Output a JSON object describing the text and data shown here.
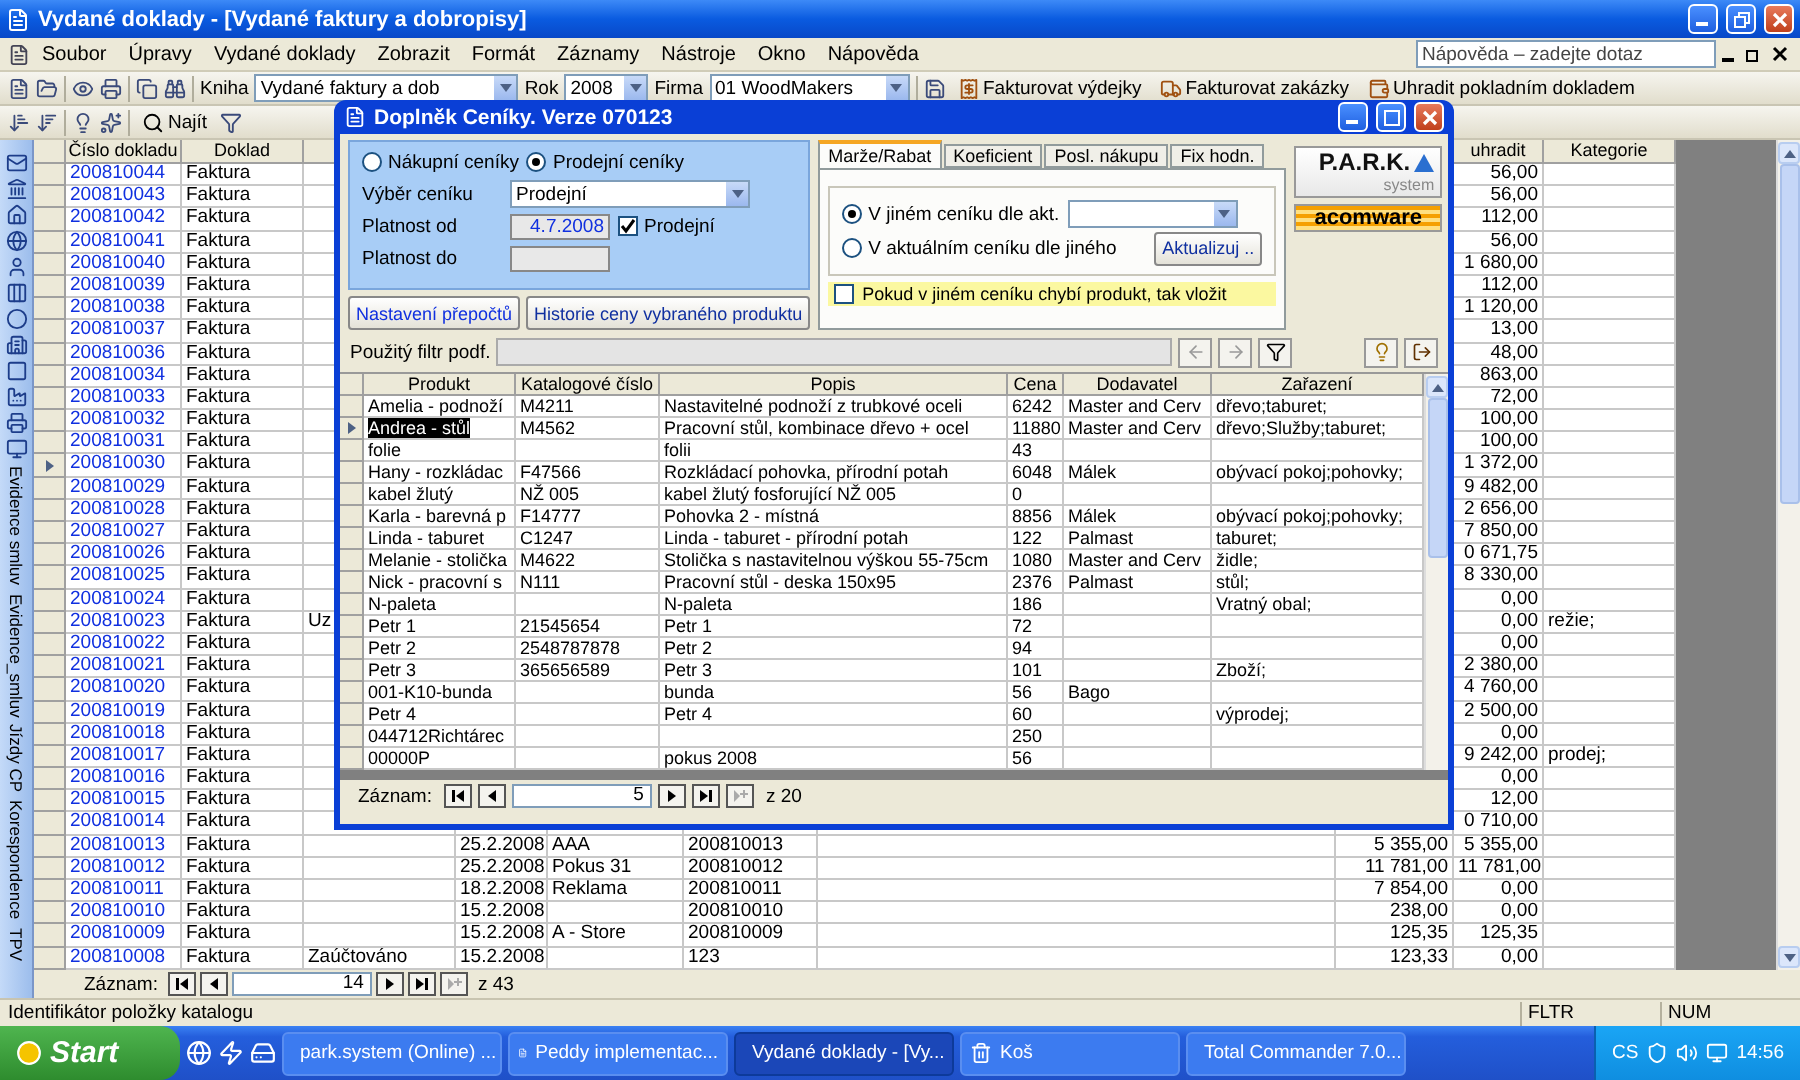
{
  "window": {
    "title": "Vydané doklady - [Vydané faktury a dobropisy]"
  },
  "menu": [
    "Soubor",
    "Úpravy",
    "Vydané doklady",
    "Zobrazit",
    "Formát",
    "Záznamy",
    "Nástroje",
    "Okno",
    "Nápověda"
  ],
  "help_box": {
    "placeholder": "Nápověda – zadejte dotaz"
  },
  "toolbar": {
    "kniha_label": "Kniha",
    "kniha": "Vydané faktury a dob",
    "rok_label": "Rok",
    "rok": "2008",
    "firma_label": "Firma",
    "firma": "01 WoodMakers",
    "actions": [
      "Fakturovat výdejky",
      "Fakturovat zakázky",
      "Uhradit pokladním dokladem"
    ]
  },
  "toolbar2": {
    "find": "Najít"
  },
  "sidebar": {
    "tabs": [
      "Evidence smluv",
      "Evidence_smluv",
      "Jízdy CP",
      "Korespondence",
      "TPV"
    ]
  },
  "table": {
    "headers": {
      "cislo_dokladu": "Číslo dokladu",
      "doklad": "Doklad",
      "uhradit": "uhradit",
      "kategorie": "Kategorie"
    },
    "rows": [
      {
        "cislo_dokladu": "200810044",
        "doklad": "Faktura",
        "uhradit": "56,00",
        "current": false
      },
      {
        "cislo_dokladu": "200810043",
        "doklad": "Faktura",
        "uhradit": "56,00",
        "current": false
      },
      {
        "cislo_dokladu": "200810042",
        "doklad": "Faktura",
        "uhradit": "112,00",
        "current": false
      },
      {
        "cislo_dokladu": "200810041",
        "doklad": "Faktura",
        "uhradit": "56,00",
        "current": false
      },
      {
        "cislo_dokladu": "200810040",
        "doklad": "Faktura",
        "uhradit": "1 680,00",
        "current": false
      },
      {
        "cislo_dokladu": "200810039",
        "doklad": "Faktura",
        "uhradit": "112,00",
        "current": false
      },
      {
        "cislo_dokladu": "200810038",
        "doklad": "Faktura",
        "uhradit": "1 120,00",
        "current": false
      },
      {
        "cislo_dokladu": "200810037",
        "doklad": "Faktura",
        "uhradit": "13,00",
        "current": false
      },
      {
        "cislo_dokladu": "200810036",
        "doklad": "Faktura",
        "uhradit": "48,00",
        "current": false
      },
      {
        "cislo_dokladu": "200810034",
        "doklad": "Faktura",
        "uhradit": "863,00",
        "current": false
      },
      {
        "cislo_dokladu": "200810033",
        "doklad": "Faktura",
        "uhradit": "72,00",
        "current": false
      },
      {
        "cislo_dokladu": "200810032",
        "doklad": "Faktura",
        "uhradit": "100,00",
        "current": false
      },
      {
        "cislo_dokladu": "200810031",
        "doklad": "Faktura",
        "uhradit": "100,00",
        "current": false
      },
      {
        "cislo_dokladu": "200810030",
        "doklad": "Faktura",
        "uhradit": "1 372,00",
        "current": true
      },
      {
        "cislo_dokladu": "200810029",
        "doklad": "Faktura",
        "uhradit": "9 482,00",
        "current": false
      },
      {
        "cislo_dokladu": "200810028",
        "doklad": "Faktura",
        "uhradit": "2 656,00",
        "current": false
      },
      {
        "cislo_dokladu": "200810027",
        "doklad": "Faktura",
        "uhradit": "7 850,00",
        "current": false
      },
      {
        "cislo_dokladu": "200810026",
        "doklad": "Faktura",
        "uhradit": "0 671,75",
        "current": false
      },
      {
        "cislo_dokladu": "200810025",
        "doklad": "Faktura",
        "uhradit": "8 330,00",
        "current": false
      },
      {
        "cislo_dokladu": "200810024",
        "doklad": "Faktura",
        "uhradit": "0,00",
        "current": false
      },
      {
        "cislo_dokladu": "200810023",
        "doklad": "Faktura",
        "column_3": "Uz",
        "uhradit": "0,00",
        "kategorie": "režie;",
        "current": false
      },
      {
        "cislo_dokladu": "200810022",
        "doklad": "Faktura",
        "uhradit": "0,00",
        "current": false
      },
      {
        "cislo_dokladu": "200810021",
        "doklad": "Faktura",
        "uhradit": "2 380,00",
        "current": false
      },
      {
        "cislo_dokladu": "200810020",
        "doklad": "Faktura",
        "uhradit": "4 760,00",
        "current": false
      },
      {
        "cislo_dokladu": "200810019",
        "doklad": "Faktura",
        "uhradit": "2 500,00",
        "current": false
      },
      {
        "cislo_dokladu": "200810018",
        "doklad": "Faktura",
        "uhradit": "0,00",
        "current": false
      },
      {
        "cislo_dokladu": "200810017",
        "doklad": "Faktura",
        "uhradit": "9 242,00",
        "kategorie": "prodej;",
        "current": false
      },
      {
        "cislo_dokladu": "200810016",
        "doklad": "Faktura",
        "uhradit": "0,00",
        "current": false
      },
      {
        "cislo_dokladu": "200810015",
        "doklad": "Faktura",
        "uhradit": "12,00",
        "current": false
      },
      {
        "cislo_dokladu": "200810014",
        "doklad": "Faktura",
        "uhradit": "0 710,00",
        "current": false
      },
      {
        "cislo_dokladu": "200810013",
        "doklad": "Faktura",
        "column_4": "25.2.2008",
        "column_5": "AAA",
        "column_6": "200810013",
        "column_8": "5 355,00",
        "uhradit": "5 355,00",
        "current": false
      },
      {
        "cislo_dokladu": "200810012",
        "doklad": "Faktura",
        "column_4": "25.2.2008",
        "column_5": "Pokus 31",
        "column_6": "200810012",
        "column_8": "11 781,00",
        "uhradit": "11 781,00",
        "current": false
      },
      {
        "cislo_dokladu": "200810011",
        "doklad": "Faktura",
        "column_4": "18.2.2008",
        "column_5": "Reklama",
        "column_6": "200810011",
        "column_8": "7 854,00",
        "uhradit": "0,00",
        "current": false
      },
      {
        "cislo_dokladu": "200810010",
        "doklad": "Faktura",
        "column_4": "15.2.2008",
        "column_6": "200810010",
        "column_8": "238,00",
        "uhradit": "0,00",
        "current": false
      },
      {
        "cislo_dokladu": "200810009",
        "doklad": "Faktura",
        "column_4": "15.2.2008",
        "column_5": "A - Store",
        "column_6": "200810009",
        "column_8": "125,35",
        "uhradit": "125,35",
        "current": false
      },
      {
        "cislo_dokladu": "200810008",
        "doklad": "Faktura",
        "column_3": "Zaúčtováno",
        "column_4": "15.2.2008",
        "column_6": "123",
        "column_8": "123,33",
        "uhradit": "0,00",
        "current": false
      }
    ]
  },
  "record_nav": {
    "label": "Záznam:",
    "current": "14",
    "total": "z 43"
  },
  "dialog": {
    "title": "Doplněk Ceníky. Verze 070123",
    "pricelist_type": [
      {
        "label": "Nákupní ceníky",
        "selected": false
      },
      {
        "label": "Prodejní ceníky",
        "selected": true
      }
    ],
    "pricelist": {
      "label": "Výběr ceníku",
      "value": "Prodejní"
    },
    "valid_from": {
      "label": "Platnost od",
      "value": "4.7.2008"
    },
    "valid_to": {
      "label": "Platnost do"
    },
    "sale_checkbox": {
      "label": "Prodejní",
      "checked": true
    },
    "buttons": [
      "Nastavení přepočtů",
      "Historie ceny vybraného produktu"
    ],
    "tabs": [
      {
        "label": "Marže/Rabat",
        "selected": true
      },
      {
        "label": "Koeficient",
        "selected": false
      },
      {
        "label": "Posl. nákupu",
        "selected": false
      },
      {
        "label": "Fix hodn.",
        "selected": false
      }
    ],
    "options": [
      {
        "label": "V jiném ceníku dle akt.",
        "selected": true
      },
      {
        "label": "V aktuálním ceníku dle jiného",
        "selected": false
      }
    ],
    "update_button": "Aktualizuj ..",
    "insert_checkbox": {
      "label": "Pokud v jiném ceníku chybí produkt, tak vložit",
      "checked": false
    },
    "logo_park": {
      "name": "P.A.R.K.",
      "sub": "system"
    },
    "logo_acomware": "acomware",
    "filter": {
      "label": "Použitý filtr podf."
    },
    "table": {
      "columns": [
        "Produkt",
        "Katalogové číslo",
        "Popis",
        "Cena",
        "Dodavatel",
        "Zařazení"
      ],
      "rows": [
        {
          "cells": {
            "produkt": "Amelia - podnoží",
            "katalogove_cislo": "M4211",
            "popis": "Nastavitelné podnoží z trubkové oceli",
            "cena": "6242",
            "dodavatel": "Master and Cerv",
            "zarazeni": "dřevo;taburet;"
          },
          "current": false
        },
        {
          "cells": {
            "produkt": "Andrea - stůl",
            "katalogove_cislo": "M4562",
            "popis": "Pracovní stůl, kombinace dřevo + ocel",
            "cena": "11880",
            "dodavatel": "Master and Cerv",
            "zarazeni": "dřevo;Služby;taburet;"
          },
          "current": true
        },
        {
          "cells": {
            "produkt": "folie",
            "popis": "folii",
            "cena": "43"
          },
          "current": false
        },
        {
          "cells": {
            "produkt": "Hany - rozkládac",
            "katalogove_cislo": "F47566",
            "popis": "Rozkládací pohovka, přírodní potah",
            "cena": "6048",
            "dodavatel": "Málek",
            "zarazeni": "obývací pokoj;pohovky;"
          },
          "current": false
        },
        {
          "cells": {
            "produkt": "kabel žlutý",
            "katalogove_cislo": "NŽ 005",
            "popis": "kabel žlutý fosforující NŽ 005",
            "cena": "0"
          },
          "current": false
        },
        {
          "cells": {
            "produkt": "Karla - barevná p",
            "katalogove_cislo": "F14777",
            "popis": "Pohovka 2 - místná",
            "cena": "8856",
            "dodavatel": "Málek",
            "zarazeni": "obývací pokoj;pohovky;"
          },
          "current": false
        },
        {
          "cells": {
            "produkt": "Linda - taburet",
            "katalogove_cislo": "C1247",
            "popis": "Linda - taburet - přírodní potah",
            "cena": "122",
            "dodavatel": "Palmast",
            "zarazeni": "taburet;"
          },
          "current": false
        },
        {
          "cells": {
            "produkt": "Melanie - stolička",
            "katalogove_cislo": "M4622",
            "popis": "Stolička s nastavitelnou výškou 55-75cm",
            "cena": "1080",
            "dodavatel": "Master and Cerv",
            "zarazeni": "židle;"
          },
          "current": false
        },
        {
          "cells": {
            "produkt": "Nick - pracovní s",
            "katalogove_cislo": "N111",
            "popis": "Pracovní stůl - deska 150x95",
            "cena": "2376",
            "dodavatel": "Palmast",
            "zarazeni": "stůl;"
          },
          "current": false
        },
        {
          "cells": {
            "produkt": "N-paleta",
            "popis": "N-paleta",
            "cena": "186",
            "zarazeni": "Vratný obal;"
          },
          "current": false
        },
        {
          "cells": {
            "produkt": "Petr 1",
            "katalogove_cislo": "21545654",
            "popis": "Petr 1",
            "cena": "72"
          },
          "current": false
        },
        {
          "cells": {
            "produkt": "Petr 2",
            "katalogove_cislo": "2548787878",
            "popis": "Petr 2",
            "cena": "94"
          },
          "current": false
        },
        {
          "cells": {
            "produkt": "Petr 3",
            "katalogove_cislo": "365656589",
            "popis": "Petr 3",
            "cena": "101",
            "zarazeni": "Zboží;"
          },
          "current": false
        },
        {
          "cells": {
            "produkt": "001-K10-bunda",
            "popis": "bunda",
            "cena": "56",
            "dodavatel": "Bago"
          },
          "current": false
        },
        {
          "cells": {
            "produkt": "Petr 4",
            "popis": "Petr 4",
            "cena": "60",
            "zarazeni": "výprodej;"
          },
          "current": false
        },
        {
          "cells": {
            "produkt": "044712Richtárec",
            "cena": "250"
          },
          "current": false
        },
        {
          "cells": {
            "produkt": "00000P",
            "popis": "pokus 2008",
            "cena": "56"
          },
          "current": false
        }
      ]
    },
    "record_nav": {
      "label": "Záznam:",
      "current": "5",
      "total": "z 20"
    }
  },
  "status_bar": {
    "text": "Identifikátor položky katalogu",
    "indicators": [
      "FLTR",
      "NUM"
    ]
  },
  "taskbar": {
    "start": "Start",
    "tasks": [
      {
        "label": "park.system (Online) ...",
        "selected": false
      },
      {
        "label": "Peddy   implementac...",
        "selected": false
      },
      {
        "label": "Vydané doklady - [Vy...",
        "selected": true
      },
      {
        "label": "Koš",
        "selected": false
      },
      {
        "label": "Total Commander 7.0...",
        "selected": false
      }
    ],
    "language": "CS",
    "clock": "14:56"
  }
}
